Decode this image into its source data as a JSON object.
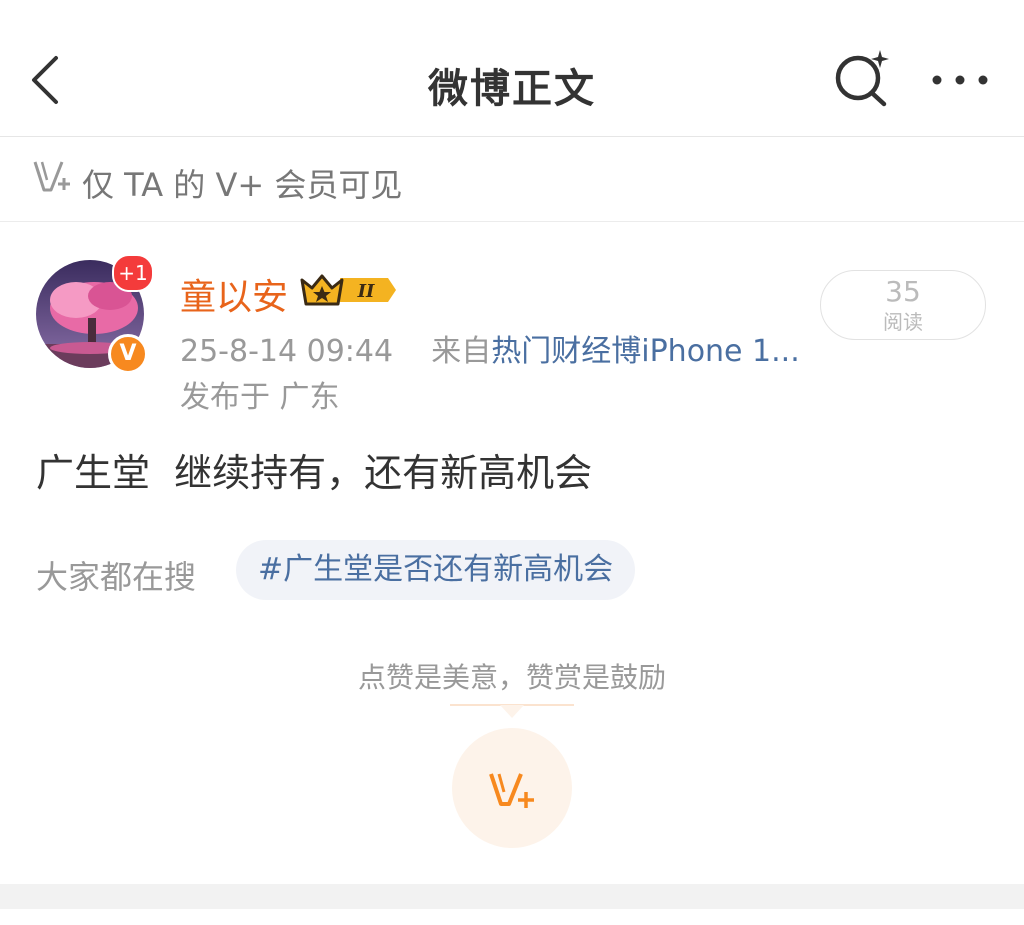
{
  "header": {
    "title": "微博正文"
  },
  "visibility": {
    "text": "仅 TA 的 V+ 会员可见"
  },
  "author": {
    "avatar_badge": "+1",
    "verified_mark": "V",
    "name": "童以安",
    "rank_badge": "II",
    "time": "25-8-14 09:44",
    "source_prefix": "来自",
    "source": "热门财经博iPhone 1...",
    "location": "发布于 广东"
  },
  "read": {
    "count": "35",
    "label": "阅读"
  },
  "post": {
    "text": "广生堂  继续持有，还有新高机会"
  },
  "search": {
    "label": "大家都在搜",
    "topic": "#广生堂是否还有新高机会"
  },
  "reward": {
    "tip": "点赞是美意，赞赏是鼓励"
  },
  "colors": {
    "accent_orange": "#f7891f",
    "name_orange": "#e8641b",
    "link_blue": "#4a6fa1",
    "badge_red": "#f43b3b"
  }
}
